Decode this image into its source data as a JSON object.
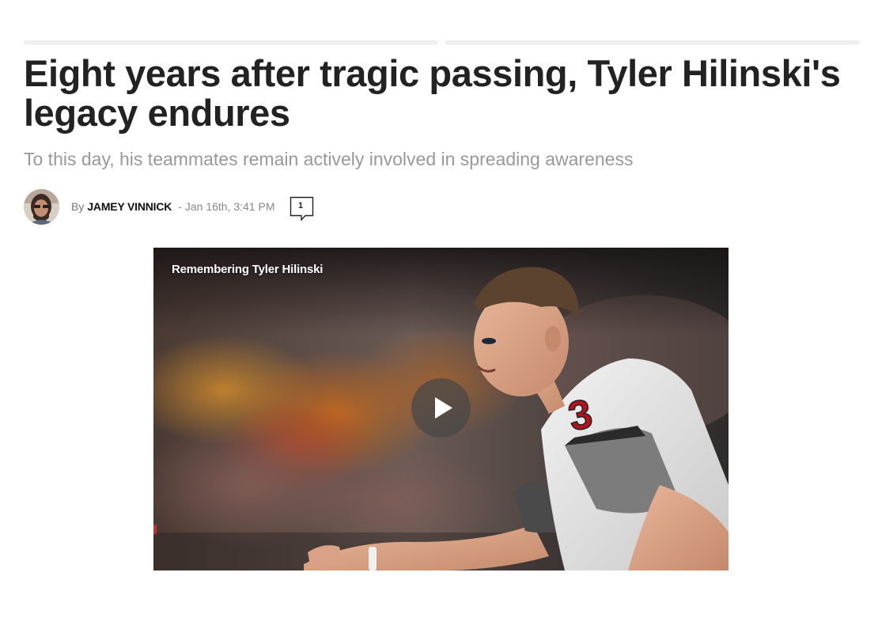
{
  "article": {
    "headline": "Eight years after tragic passing, Tyler Hilinski's legacy endures",
    "subheadline": "To this day, his teammates remain actively involved in spreading awareness",
    "byline": {
      "prefix": "By",
      "author": "JAMEY VINNICK",
      "separator": "-",
      "date": "Jan 16th, 3:41 PM",
      "comment_count": "1"
    }
  },
  "video": {
    "title": "Remembering Tyler Hilinski",
    "jersey_number": "3"
  },
  "icons": {
    "avatar": "author-avatar",
    "comment": "comment-bubble-icon",
    "play": "play-icon"
  },
  "colors": {
    "headline": "#222222",
    "subheadline": "#999999",
    "jersey_red": "#b3121f"
  }
}
